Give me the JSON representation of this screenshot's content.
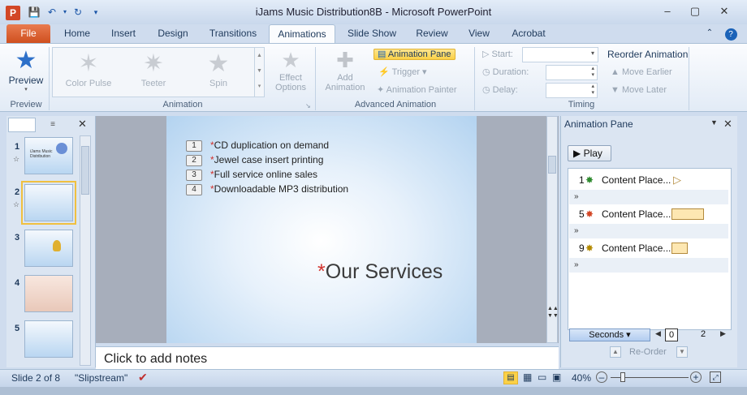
{
  "window": {
    "title": "iJams Music Distribution8B  -  Microsoft PowerPoint",
    "app_icon": "P",
    "controls": {
      "minimize": "–",
      "maximize": "▢",
      "close": "✕"
    }
  },
  "tabs": [
    {
      "label": "File"
    },
    {
      "label": "Home"
    },
    {
      "label": "Insert"
    },
    {
      "label": "Design"
    },
    {
      "label": "Transitions"
    },
    {
      "label": "Animations"
    },
    {
      "label": "Slide Show"
    },
    {
      "label": "Review"
    },
    {
      "label": "View"
    },
    {
      "label": "Acrobat"
    }
  ],
  "ribbon": {
    "preview": {
      "label": "Preview",
      "group": "Preview"
    },
    "animation_group": {
      "label": "Animation",
      "gallery": [
        "Color Pulse",
        "Teeter",
        "Spin"
      ],
      "effect_options_line1": "Effect",
      "effect_options_line2": "Options"
    },
    "advanced": {
      "label": "Advanced Animation",
      "add_line1": "Add",
      "add_line2": "Animation",
      "animation_pane": "Animation Pane",
      "trigger": "Trigger",
      "animation_painter": "Animation Painter"
    },
    "timing": {
      "label": "Timing",
      "start": "Start:",
      "duration": "Duration:",
      "delay": "Delay:",
      "reorder": "Reorder Animation",
      "move_earlier": "Move Earlier",
      "move_later": "Move Later"
    }
  },
  "slides_pane": {
    "thumbs": [
      {
        "num": "1",
        "text_line1": "iJams Music",
        "text_line2": "Distribution"
      },
      {
        "num": "2",
        "text_line1": "",
        "text_line2": ""
      },
      {
        "num": "3",
        "text_line1": "",
        "text_line2": ""
      },
      {
        "num": "4",
        "text_line1": "",
        "text_line2": ""
      },
      {
        "num": "5",
        "text_line1": "",
        "text_line2": ""
      }
    ]
  },
  "slide": {
    "bullets": [
      {
        "num": "1",
        "text": "CD duplication on demand"
      },
      {
        "num": "2",
        "text": "Jewel case insert printing"
      },
      {
        "num": "3",
        "text": "Full service online sales"
      },
      {
        "num": "4",
        "text": "Downloadable MP3 distribution"
      }
    ],
    "asterisk": "*",
    "title": "Our Services"
  },
  "notes": {
    "placeholder": "Click to add notes"
  },
  "animation_pane": {
    "title": "Animation Pane",
    "play": "Play",
    "items": [
      {
        "num": "1",
        "label": "Content Place..."
      },
      {
        "num": "5",
        "label": "Content Place..."
      },
      {
        "num": "9",
        "label": "Content Place..."
      }
    ],
    "expand": "»",
    "seconds": "Seconds",
    "timeline_start": "0",
    "timeline_end": "2",
    "reorder": "Re-Order"
  },
  "status": {
    "slide": "Slide 2 of 8",
    "theme": "\"Slipstream\"",
    "zoom": "40%"
  },
  "colors": {
    "file_tab": "#d24726",
    "accent": "#1e395b",
    "highlight": "#fbd147"
  }
}
